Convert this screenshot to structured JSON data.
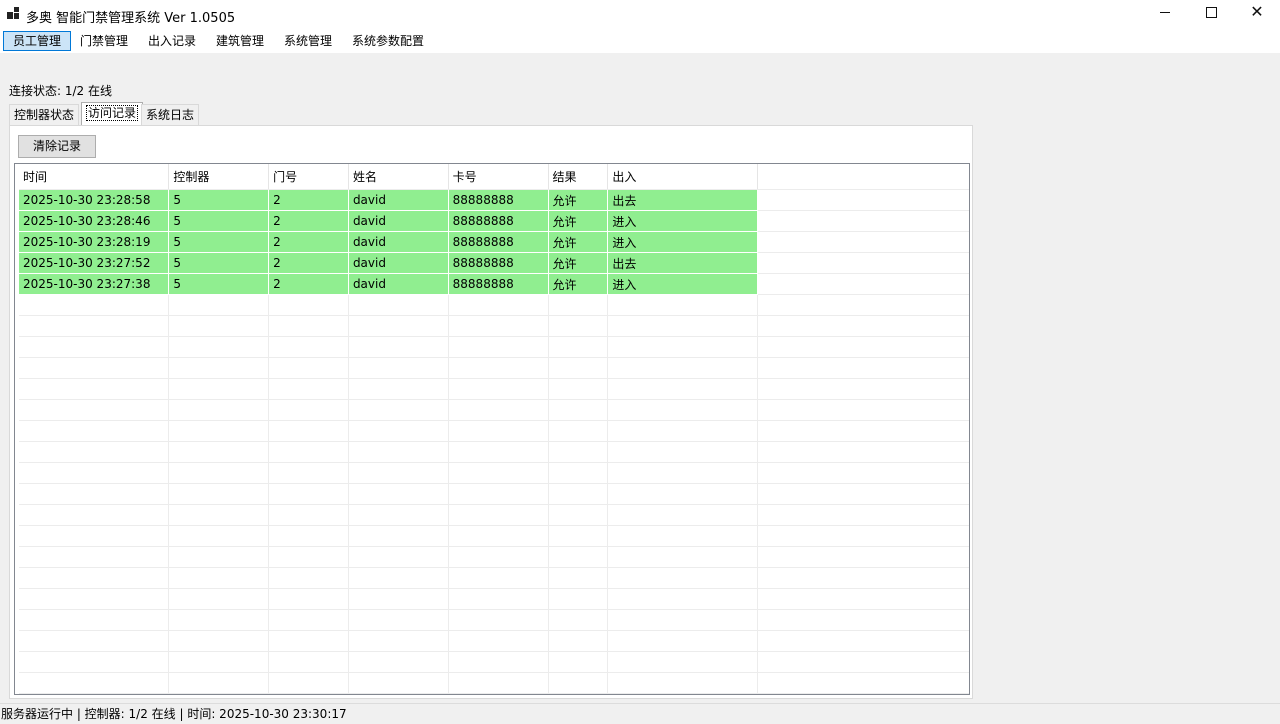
{
  "window": {
    "title": "多奥 智能门禁管理系统 Ver 1.0505",
    "minimize_icon": "minimize-icon",
    "maximize_icon": "maximize-icon",
    "close_icon": "close-icon"
  },
  "menu": {
    "items": [
      {
        "label": "员工管理",
        "active": true
      },
      {
        "label": "门禁管理"
      },
      {
        "label": "出入记录"
      },
      {
        "label": "建筑管理"
      },
      {
        "label": "系统管理"
      },
      {
        "label": "系统参数配置"
      }
    ]
  },
  "connection_status": "连接状态: 1/2 在线",
  "tabs": [
    {
      "label": "控制器状态"
    },
    {
      "label": "访问记录",
      "selected": true
    },
    {
      "label": "系统日志"
    }
  ],
  "toolbar": {
    "clear_label": "清除记录"
  },
  "grid": {
    "columns": [
      "时间",
      "控制器",
      "门号",
      "姓名",
      "卡号",
      "结果",
      "出入"
    ],
    "rows": [
      [
        "2025-10-30 23:28:58",
        "5",
        "2",
        "david",
        "88888888",
        "允许",
        "出去"
      ],
      [
        "2025-10-30 23:28:46",
        "5",
        "2",
        "david",
        "88888888",
        "允许",
        "进入"
      ],
      [
        "2025-10-30 23:28:19",
        "5",
        "2",
        "david",
        "88888888",
        "允许",
        "进入"
      ],
      [
        "2025-10-30 23:27:52",
        "5",
        "2",
        "david",
        "88888888",
        "允许",
        "出去"
      ],
      [
        "2025-10-30 23:27:38",
        "5",
        "2",
        "david",
        "88888888",
        "允许",
        "进入"
      ]
    ],
    "row_highlight_color": "#90ee90"
  },
  "status_bar": "服务器运行中 | 控制器: 1/2 在线 | 时间: 2025-10-30 23:30:17"
}
